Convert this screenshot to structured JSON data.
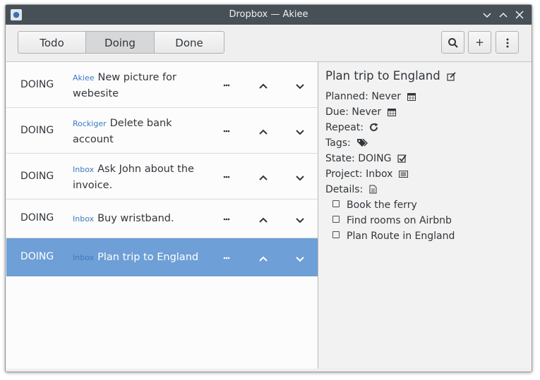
{
  "window": {
    "title": "Dropbox — Akiee"
  },
  "tabs": [
    {
      "label": "Todo",
      "active": false
    },
    {
      "label": "Doing",
      "active": true
    },
    {
      "label": "Done",
      "active": false
    }
  ],
  "toolbar": {
    "add_label": "+"
  },
  "tasks": [
    {
      "state": "DOING",
      "project": "Akiee",
      "title_line1": "New picture for",
      "title_line2": "webesite",
      "selected": false
    },
    {
      "state": "DOING",
      "project": "Rockiger",
      "title_line1": "Delete bank",
      "title_line2": "account",
      "selected": false
    },
    {
      "state": "DOING",
      "project": "Inbox",
      "title_line1": "Ask John about the",
      "title_line2": "invoice.",
      "selected": false
    },
    {
      "state": "DOING",
      "project": "Inbox",
      "title_line1": "Buy wristband.",
      "title_line2": "",
      "selected": false
    },
    {
      "state": "DOING",
      "project": "Inbox",
      "title_line1": "Plan trip to England",
      "title_line2": "",
      "selected": true
    }
  ],
  "detail": {
    "title": "Plan trip to England",
    "planned": "Planned: Never",
    "due": "Due: Never",
    "repeat": "Repeat:",
    "tags": "Tags:",
    "state": "State: DOING",
    "project": "Project: Inbox",
    "details": "Details:",
    "subtasks": [
      "Book the ferry",
      "Find rooms on Airbnb",
      "Plan Route in England"
    ]
  },
  "colors": {
    "titlebar": "#475057",
    "selection": "#6e9fd6",
    "project_link": "#3c7ac2"
  },
  "icons": [
    "edit-icon",
    "calendar-icon",
    "refresh-icon",
    "tags-icon",
    "checkbox-icon",
    "list-icon",
    "document-icon",
    "search-icon",
    "menu-icon"
  ]
}
